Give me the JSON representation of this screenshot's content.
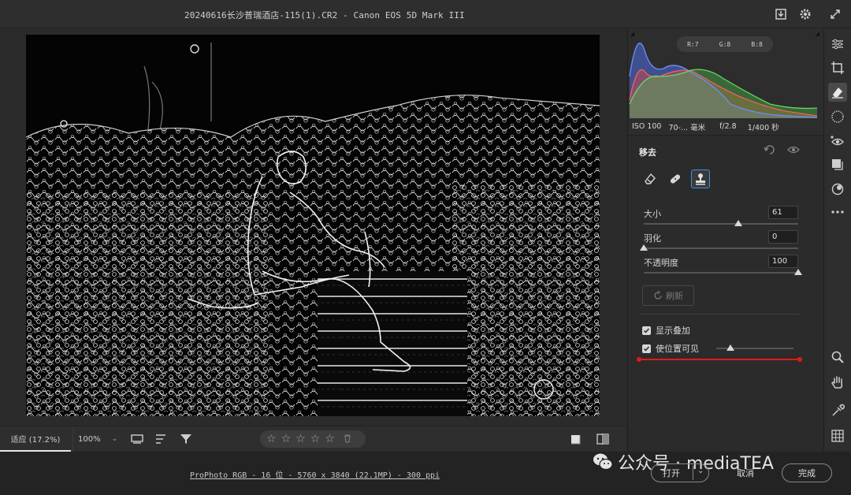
{
  "window": {
    "title": "20240616长沙普瑞酒店-115(1).CR2 -  Canon EOS 5D Mark III"
  },
  "titlebar_icons": [
    "save-download-icon",
    "gear-icon",
    "expand-icon"
  ],
  "histogram": {
    "r_label": "R:7",
    "g_label": "G:8",
    "b_label": "B:8",
    "colors": {
      "red": "#e04848",
      "green": "#48c048",
      "blue": "#4d6ee0"
    }
  },
  "exif": {
    "iso": "ISO 100",
    "focal": "70-... 毫米",
    "aperture": "f/2.8",
    "shutter": "1/400 秒"
  },
  "panel": {
    "section_title": "移去",
    "tools": [
      "eraser-icon",
      "bandage-icon",
      "clone-stamp-icon"
    ],
    "active_tool": "clone-stamp-icon",
    "sliders": [
      {
        "label": "大小",
        "value": "61",
        "level": 0.61
      },
      {
        "label": "羽化",
        "value": "0",
        "level": 0.0
      },
      {
        "label": "不透明度",
        "value": "100",
        "level": 1.0
      }
    ],
    "refresh_label": "刷新",
    "show_overlay_label": "显示叠加",
    "visualize_spots_label": "使位置可见",
    "visualize_level": 0.18
  },
  "bottombar": {
    "zoom_fit": "适应 (17.2%)",
    "zoom_100": "100%",
    "rating_stars": [
      "☆",
      "☆",
      "☆",
      "☆",
      "☆"
    ]
  },
  "infobar": {
    "workflow_link": "ProPhoto RGB - 16 位 - 5760 x 3840 (22.1MP) - 300 ppi",
    "open_label": "打开",
    "cancel_label": "取消",
    "done_label": "完成"
  },
  "watermark": {
    "text": "公众号 · mediaTEA"
  },
  "right_toolbar": [
    "sliders-icon",
    "crop-icon",
    "eraser-icon",
    "redeye-circle-icon",
    "eye-plus-icon",
    "layers-icon",
    "presets-icon",
    "more-icon",
    "zoom-icon",
    "hand-icon",
    "eyedropper-icon",
    "grid-icon"
  ],
  "accent": "#3d8fe8"
}
